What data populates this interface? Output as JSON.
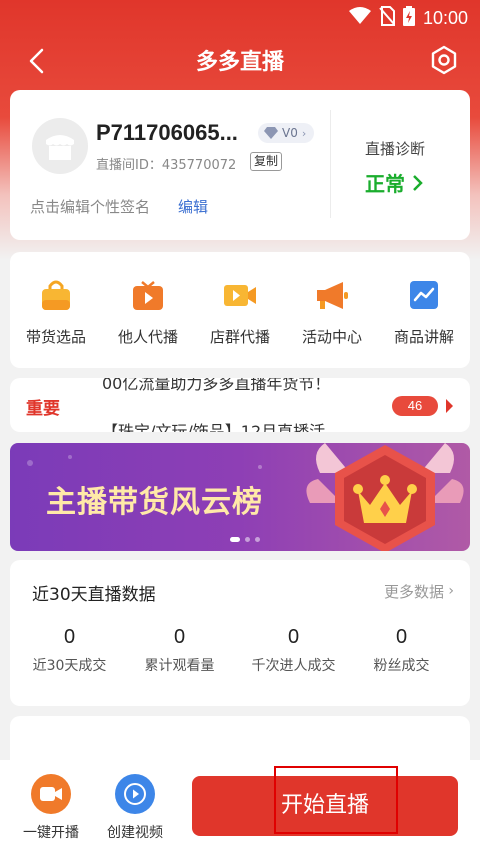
{
  "status_bar": {
    "time": "10:00",
    "icons": [
      "wifi-icon",
      "no-sim-icon",
      "battery-charging-icon"
    ]
  },
  "nav": {
    "title": "多多直播",
    "back_icon": "chevron-left-icon",
    "settings_icon": "hex-gear-icon"
  },
  "profile": {
    "name": "P711706065...",
    "vip_level": "V0",
    "room_id_label": "直播间ID：435770072",
    "copy_label": "复制",
    "signature_placeholder": "点击编辑个性签名",
    "edit_label": "编辑",
    "diagnosis_title": "直播诊断",
    "diagnosis_value": "正常",
    "diagnosis_color": "#1aad2d"
  },
  "tools": [
    {
      "label": "带货选品",
      "icon": "shopping-bag-icon"
    },
    {
      "label": "他人代播",
      "icon": "play-tv-icon"
    },
    {
      "label": "店群代播",
      "icon": "video-camera-icon"
    },
    {
      "label": "活动中心",
      "icon": "megaphone-icon"
    },
    {
      "label": "商品讲解",
      "icon": "trend-chart-icon"
    }
  ],
  "notice": {
    "tag": "重要",
    "line1": "00亿流量助力多多直播年货节！",
    "line2": "【珠宝/文玩/饰品】12月直播活",
    "count": "46"
  },
  "banner": {
    "text": "主播带货风云榜"
  },
  "stats": {
    "title": "近30天直播数据",
    "more_label": "更多数据",
    "items": [
      {
        "value": "0",
        "label": "近30天成交"
      },
      {
        "value": "0",
        "label": "累计观看量"
      },
      {
        "value": "0",
        "label": "千次进人成交"
      },
      {
        "value": "0",
        "label": "粉丝成交"
      }
    ]
  },
  "bottom_bar": {
    "quick_start_label": "一键开播",
    "create_video_label": "创建视频",
    "start_live_label": "开始直播"
  },
  "colors": {
    "brand_red": "#e0362b",
    "link_blue": "#3b6fd1",
    "icon_orange": "#f07a2a",
    "icon_blue": "#3d86e8"
  }
}
